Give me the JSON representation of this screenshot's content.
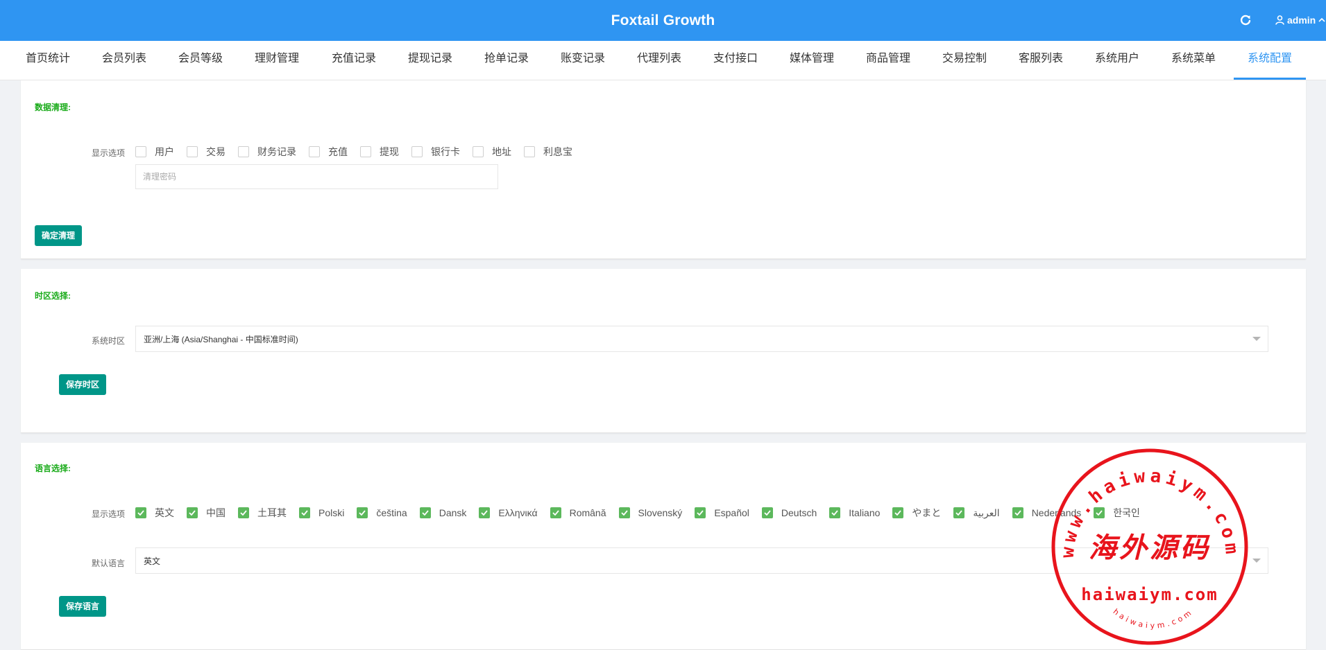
{
  "header": {
    "title": "Foxtail Growth",
    "user": "admin"
  },
  "nav": [
    "首页统计",
    "会员列表",
    "会员等级",
    "理财管理",
    "充值记录",
    "提现记录",
    "抢单记录",
    "账变记录",
    "代理列表",
    "支付接口",
    "媒体管理",
    "商品管理",
    "交易控制",
    "客服列表",
    "系统用户",
    "系统菜单",
    "系统配置"
  ],
  "nav_active": "系统配置",
  "cleanup": {
    "title": "数据清理:",
    "label": "显示选项",
    "options": [
      {
        "label": "用户",
        "checked": false
      },
      {
        "label": "交易",
        "checked": false
      },
      {
        "label": "财务记录",
        "checked": false
      },
      {
        "label": "充值",
        "checked": false
      },
      {
        "label": "提现",
        "checked": false
      },
      {
        "label": "银行卡",
        "checked": false
      },
      {
        "label": "地址",
        "checked": false
      },
      {
        "label": "利息宝",
        "checked": false
      }
    ],
    "password_placeholder": "清理密码",
    "confirm_button": "确定清理"
  },
  "timezone": {
    "title": "时区选择:",
    "label": "系统时区",
    "value": "亚洲/上海 (Asia/Shanghai - 中国标准时间)",
    "save_button": "保存时区"
  },
  "language": {
    "title": "语言选择:",
    "label": "显示选项",
    "options": [
      {
        "label": "英文",
        "checked": true
      },
      {
        "label": "中国",
        "checked": true
      },
      {
        "label": "土耳其",
        "checked": true
      },
      {
        "label": "Polski",
        "checked": true
      },
      {
        "label": "čeština",
        "checked": true
      },
      {
        "label": "Dansk",
        "checked": true
      },
      {
        "label": "Ελληνικά",
        "checked": true
      },
      {
        "label": "Română",
        "checked": true
      },
      {
        "label": "Slovenský",
        "checked": true
      },
      {
        "label": "Español",
        "checked": true
      },
      {
        "label": "Deutsch",
        "checked": true
      },
      {
        "label": "Italiano",
        "checked": true
      },
      {
        "label": "やまと",
        "checked": true
      },
      {
        "label": "العربية",
        "checked": true
      },
      {
        "label": "Nederlands",
        "checked": true
      },
      {
        "label": "한국인",
        "checked": true
      }
    ],
    "default_label": "默认语言",
    "default_value": "英文",
    "save_button": "保存语言"
  },
  "watermark": {
    "arc_text": "www.haiwaiym.com",
    "center_text": "海外源码",
    "domain_text": "haiwaiym.com",
    "bottom_text": "haiwaiym.com",
    "color": "#e8141c"
  },
  "colors": {
    "header": "#2f95f2",
    "button": "#009688",
    "section_title": "#1aab1a",
    "checkbox": "#5cb85c"
  }
}
